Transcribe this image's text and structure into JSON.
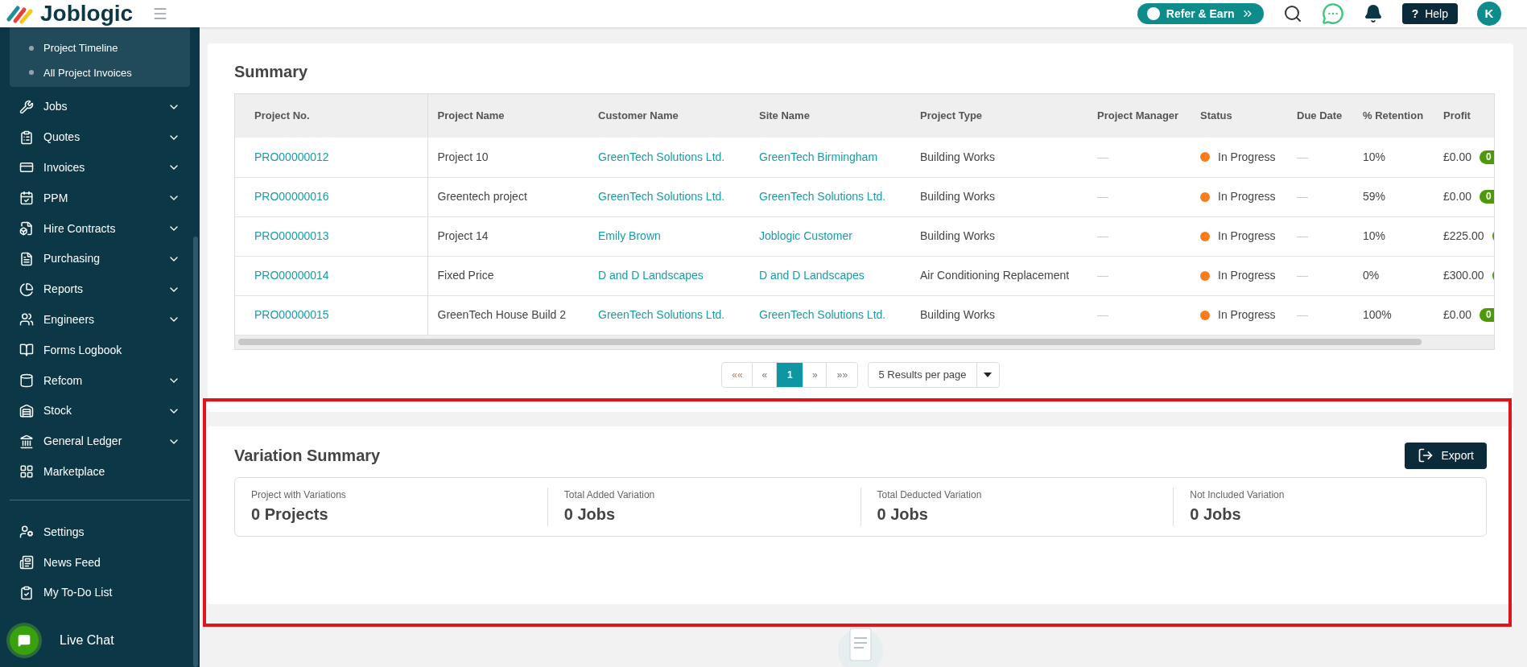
{
  "header": {
    "logo": "Joblogic",
    "refer_button": "Refer & Earn",
    "help_icon": "?",
    "help_button": "Help",
    "avatar": "K"
  },
  "sidebar": {
    "submenu": [
      {
        "label": "Project Timeline"
      },
      {
        "label": "All Project Invoices"
      }
    ],
    "items": [
      {
        "label": "Jobs",
        "expandable": true
      },
      {
        "label": "Quotes",
        "expandable": true
      },
      {
        "label": "Invoices",
        "expandable": true
      },
      {
        "label": "PPM",
        "expandable": true
      },
      {
        "label": "Hire Contracts",
        "expandable": true
      },
      {
        "label": "Purchasing",
        "expandable": true
      },
      {
        "label": "Reports",
        "expandable": true
      },
      {
        "label": "Engineers",
        "expandable": true
      },
      {
        "label": "Forms Logbook",
        "expandable": false
      },
      {
        "label": "Refcom",
        "expandable": true
      },
      {
        "label": "Stock",
        "expandable": true
      },
      {
        "label": "General Ledger",
        "expandable": true
      },
      {
        "label": "Marketplace",
        "expandable": false
      }
    ],
    "bottom_items": [
      {
        "label": "Settings"
      },
      {
        "label": "News Feed"
      },
      {
        "label": "My To-Do List"
      }
    ],
    "live_chat": "Live Chat"
  },
  "summary": {
    "title": "Summary",
    "columns": [
      "Project No.",
      "Project Name",
      "Customer Name",
      "Site Name",
      "Project Type",
      "Project Manager",
      "Status",
      "Due Date",
      "% Retention",
      "Profit"
    ],
    "rows": [
      {
        "project_no": "PRO00000012",
        "project_name": "Project 10",
        "customer": "GreenTech Solutions Ltd.",
        "site": "GreenTech Birmingham",
        "type": "Building Works",
        "manager": "—",
        "status": "In Progress",
        "color": "#f97d1c",
        "due": "—",
        "retention": "10%",
        "profit": "£0.00",
        "badge": "0"
      },
      {
        "project_no": "PRO00000016",
        "project_name": "Greentech project",
        "customer": "GreenTech Solutions Ltd.",
        "site": "GreenTech Solutions Ltd.",
        "type": "Building Works",
        "manager": "—",
        "status": "In Progress",
        "color": "#f97d1c",
        "due": "—",
        "retention": "59%",
        "profit": "£0.00",
        "badge": "0"
      },
      {
        "project_no": "PRO00000013",
        "project_name": "Project 14",
        "customer": "Emily Brown",
        "site": "Joblogic Customer",
        "type": "Building Works",
        "manager": "—",
        "status": "In Progress",
        "color": "#f97d1c",
        "due": "—",
        "retention": "10%",
        "profit": "£225.00"
      },
      {
        "project_no": "PRO00000014",
        "project_name": "Fixed Price",
        "customer": "D and D Landscapes",
        "site": "D and D Landscapes",
        "type": "Air Conditioning Replacement",
        "manager": "—",
        "status": "In Progress",
        "color": "#f97d1c",
        "due": "—",
        "retention": "0%",
        "profit": "£300.00"
      },
      {
        "project_no": "PRO00000015",
        "project_name": "GreenTech House Build 2",
        "customer": "GreenTech Solutions Ltd.",
        "site": "GreenTech Solutions Ltd.",
        "type": "Building Works",
        "manager": "—",
        "status": "In Progress",
        "color": "#f97d1c",
        "due": "—",
        "retention": "100%",
        "profit": "£0.00",
        "badge": "0"
      }
    ],
    "pagination": {
      "first": "««",
      "prev": "«",
      "pages": [
        {
          "label": "1",
          "selected": true
        }
      ],
      "next": "»",
      "last": "»»",
      "page_size": "5 Results per page"
    }
  },
  "variation_summary": {
    "title": "Variation Summary",
    "export_button": "Export",
    "stats": [
      {
        "label": "Project with Variations",
        "value": "0 Projects"
      },
      {
        "label": "Total Added Variation",
        "value": "0 Jobs"
      },
      {
        "label": "Total Deducted Variation",
        "value": "0 Jobs"
      },
      {
        "label": "Not Included Variation",
        "value": "0 Jobs"
      }
    ]
  }
}
